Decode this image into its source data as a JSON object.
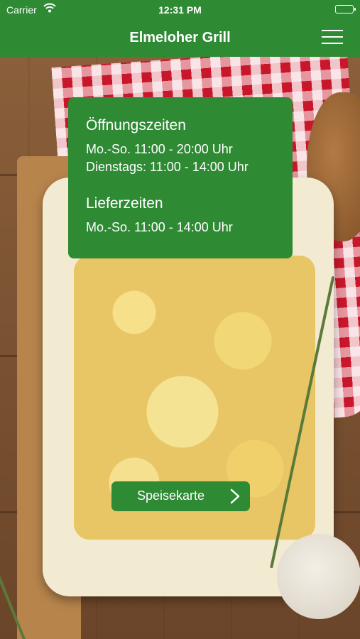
{
  "status_bar": {
    "carrier": "Carrier",
    "time": "12:31 PM",
    "wifi_icon": "wifi-icon",
    "battery_icon": "battery-icon"
  },
  "nav": {
    "title": "Elmeloher Grill",
    "menu_icon": "hamburger-menu-icon"
  },
  "hours": {
    "opening_title": "Öffnungszeiten",
    "opening_lines": [
      "Mo.-So. 11:00 - 20:00 Uhr",
      "Dienstags: 11:00 - 14:00 Uhr"
    ],
    "delivery_title": "Lieferzeiten",
    "delivery_lines": [
      "Mo.-So. 11:00 - 14:00 Uhr"
    ]
  },
  "menu_button": {
    "label": "Speisekarte",
    "icon": "chevron-right-icon"
  },
  "colors": {
    "brand_green": "#2f8a34",
    "text_on_brand": "#ffffff"
  }
}
